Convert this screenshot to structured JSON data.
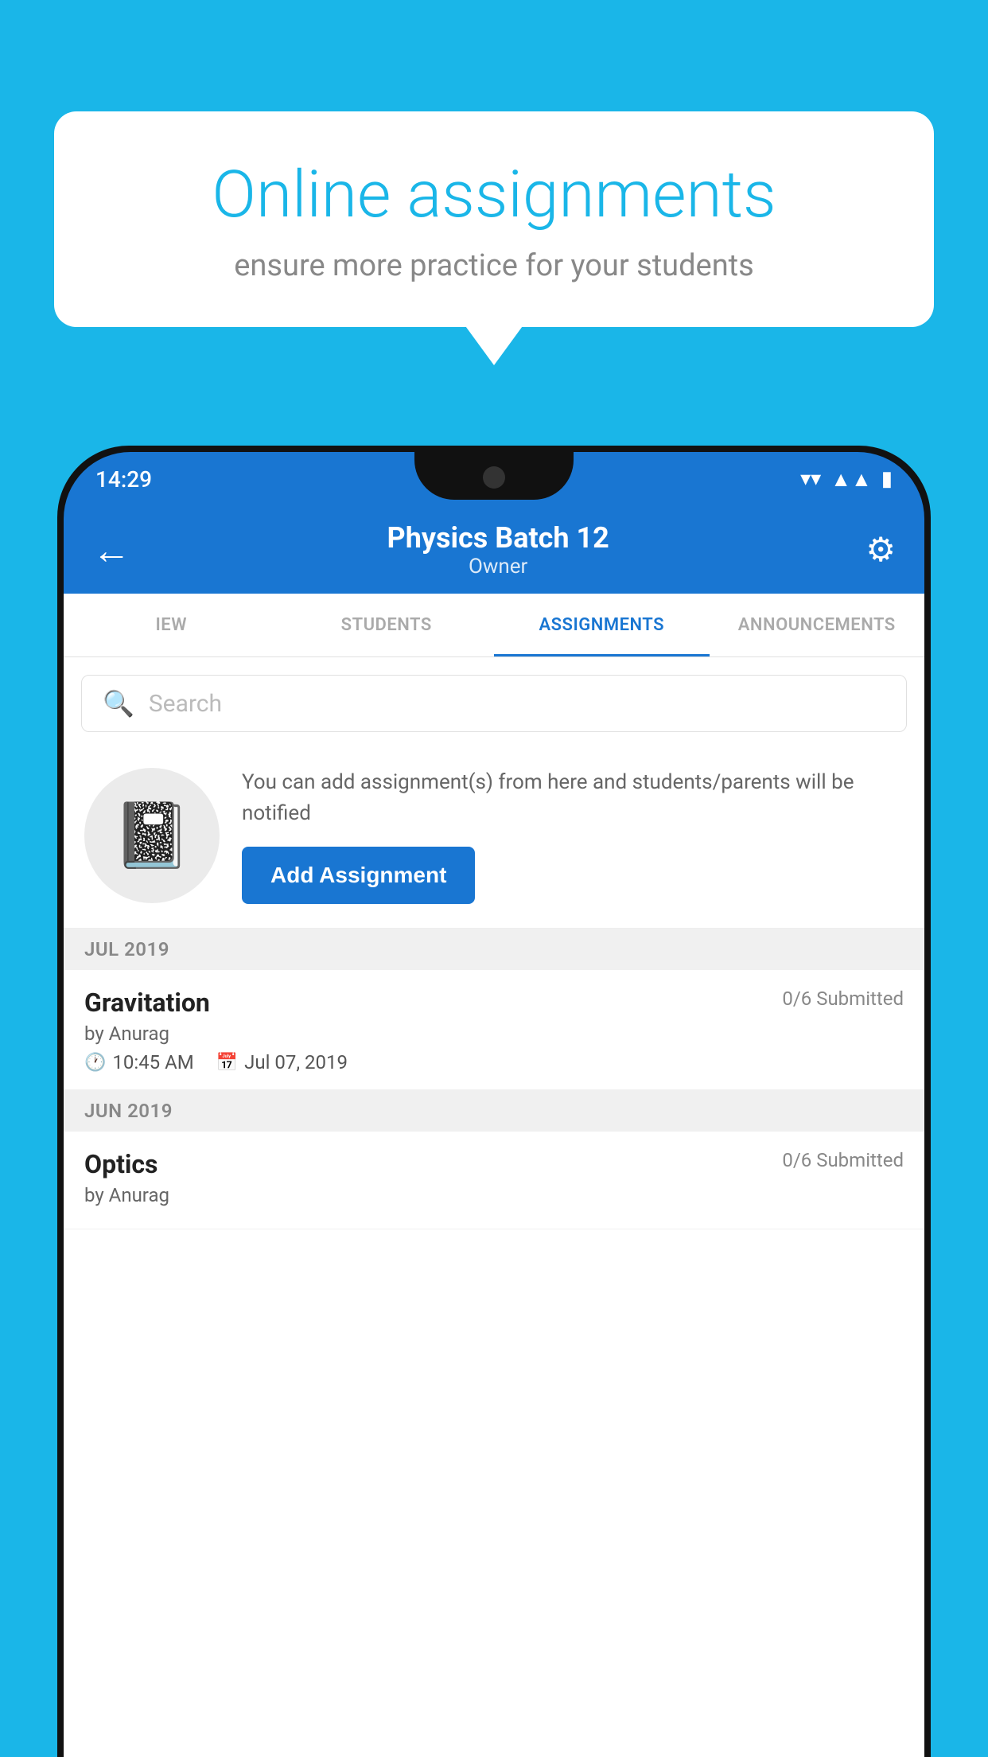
{
  "background": {
    "color": "#1ab6e8"
  },
  "speech_bubble": {
    "title": "Online assignments",
    "subtitle": "ensure more practice for your students"
  },
  "status_bar": {
    "time": "14:29",
    "wifi": "▼",
    "signal": "▲",
    "battery": "▮"
  },
  "app_bar": {
    "back_label": "←",
    "title": "Physics Batch 12",
    "subtitle": "Owner",
    "settings_label": "⚙"
  },
  "tabs": [
    {
      "label": "IEW",
      "active": false
    },
    {
      "label": "STUDENTS",
      "active": false
    },
    {
      "label": "ASSIGNMENTS",
      "active": true
    },
    {
      "label": "ANNOUNCEMENTS",
      "active": false
    }
  ],
  "search": {
    "placeholder": "Search"
  },
  "add_assignment": {
    "info_text": "You can add assignment(s) from here and students/parents will be notified",
    "button_label": "Add Assignment"
  },
  "sections": [
    {
      "label": "JUL 2019",
      "assignments": [
        {
          "name": "Gravitation",
          "submitted": "0/6 Submitted",
          "by": "by Anurag",
          "time": "10:45 AM",
          "date": "Jul 07, 2019"
        }
      ]
    },
    {
      "label": "JUN 2019",
      "assignments": [
        {
          "name": "Optics",
          "submitted": "0/6 Submitted",
          "by": "by Anurag",
          "time": "",
          "date": ""
        }
      ]
    }
  ]
}
